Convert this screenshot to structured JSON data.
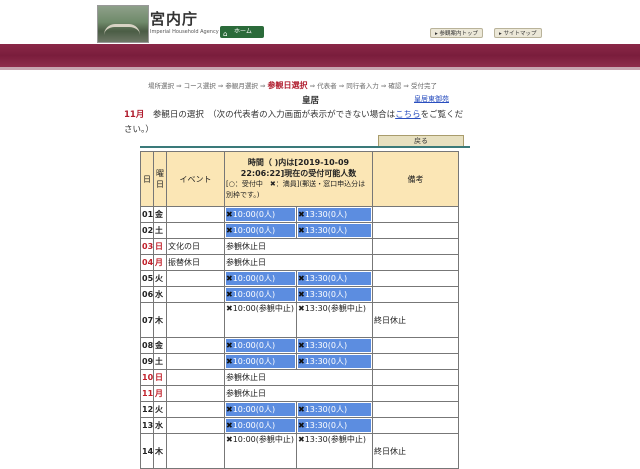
{
  "header": {
    "site_title": "宮内庁",
    "site_subtitle": "Imperial Household Agency",
    "home_label": "ホーム",
    "top_buttons": [
      "参観案内トップ",
      "サイトマップ"
    ]
  },
  "breadcrumb": {
    "steps": [
      "場所選択",
      "コース選択",
      "参観月選択"
    ],
    "current": "参観日選択",
    "after": [
      "代表者",
      "同行者入力",
      "確認",
      "受付完了"
    ],
    "separator": "⇒"
  },
  "page": {
    "subtitle": "皇居",
    "map_link": "皇居東御苑",
    "month": "11月",
    "instruction_main": "参観日の選択",
    "instruction_paren": "（次の代表者の入力画面が表示ができない場合は",
    "instruction_link": "こちら",
    "instruction_end": "をご覧ください。）",
    "back_button": "戻る"
  },
  "table": {
    "headers": {
      "day": "日",
      "weekday": "曜日",
      "event": "イベント",
      "time_title": "時間（ )内は[2019-10-09 22:06:22]現在の受付可能人数",
      "time_legend": "[○：受付中　✖：満員](郵送・窓口申込分は別枠です。)",
      "remarks": "備考"
    },
    "rows": [
      {
        "day": "01",
        "wd": "金",
        "event": "",
        "type": "slots",
        "s1": "10:00(0人)",
        "s2": "13:30(0人)",
        "remark": ""
      },
      {
        "day": "02",
        "wd": "土",
        "event": "",
        "type": "slots",
        "s1": "10:00(0人)",
        "s2": "13:30(0人)",
        "remark": ""
      },
      {
        "day": "03",
        "wd": "日",
        "event": "文化の日",
        "type": "closed",
        "closed": "参観休止日",
        "remark": "",
        "red": true
      },
      {
        "day": "04",
        "wd": "月",
        "event": "振替休日",
        "type": "closed",
        "closed": "参観休止日",
        "remark": "",
        "red": true
      },
      {
        "day": "05",
        "wd": "火",
        "event": "",
        "type": "slots",
        "s1": "10:00(0人)",
        "s2": "13:30(0人)",
        "remark": ""
      },
      {
        "day": "06",
        "wd": "水",
        "event": "",
        "type": "slots",
        "s1": "10:00(0人)",
        "s2": "13:30(0人)",
        "remark": ""
      },
      {
        "day": "07",
        "wd": "木",
        "event": "",
        "type": "stopped",
        "s1": "10:00(参観中止)",
        "s2": "13:30(参観中止)",
        "remark": "終日休止"
      },
      {
        "day": "08",
        "wd": "金",
        "event": "",
        "type": "slots",
        "s1": "10:00(0人)",
        "s2": "13:30(0人)",
        "remark": ""
      },
      {
        "day": "09",
        "wd": "土",
        "event": "",
        "type": "slots",
        "s1": "10:00(0人)",
        "s2": "13:30(0人)",
        "remark": ""
      },
      {
        "day": "10",
        "wd": "日",
        "event": "",
        "type": "closed",
        "closed": "参観休止日",
        "remark": "",
        "red": true
      },
      {
        "day": "11",
        "wd": "月",
        "event": "",
        "type": "closed",
        "closed": "参観休止日",
        "remark": "",
        "red": true
      },
      {
        "day": "12",
        "wd": "火",
        "event": "",
        "type": "slots",
        "s1": "10:00(0人)",
        "s2": "13:30(0人)",
        "remark": ""
      },
      {
        "day": "13",
        "wd": "水",
        "event": "",
        "type": "slots",
        "s1": "10:00(0人)",
        "s2": "13:30(0人)",
        "remark": ""
      },
      {
        "day": "14",
        "wd": "木",
        "event": "",
        "type": "stopped",
        "s1": "10:00(参観中止)",
        "s2": "13:30(参観中止)",
        "remark": "終日休止"
      }
    ]
  }
}
